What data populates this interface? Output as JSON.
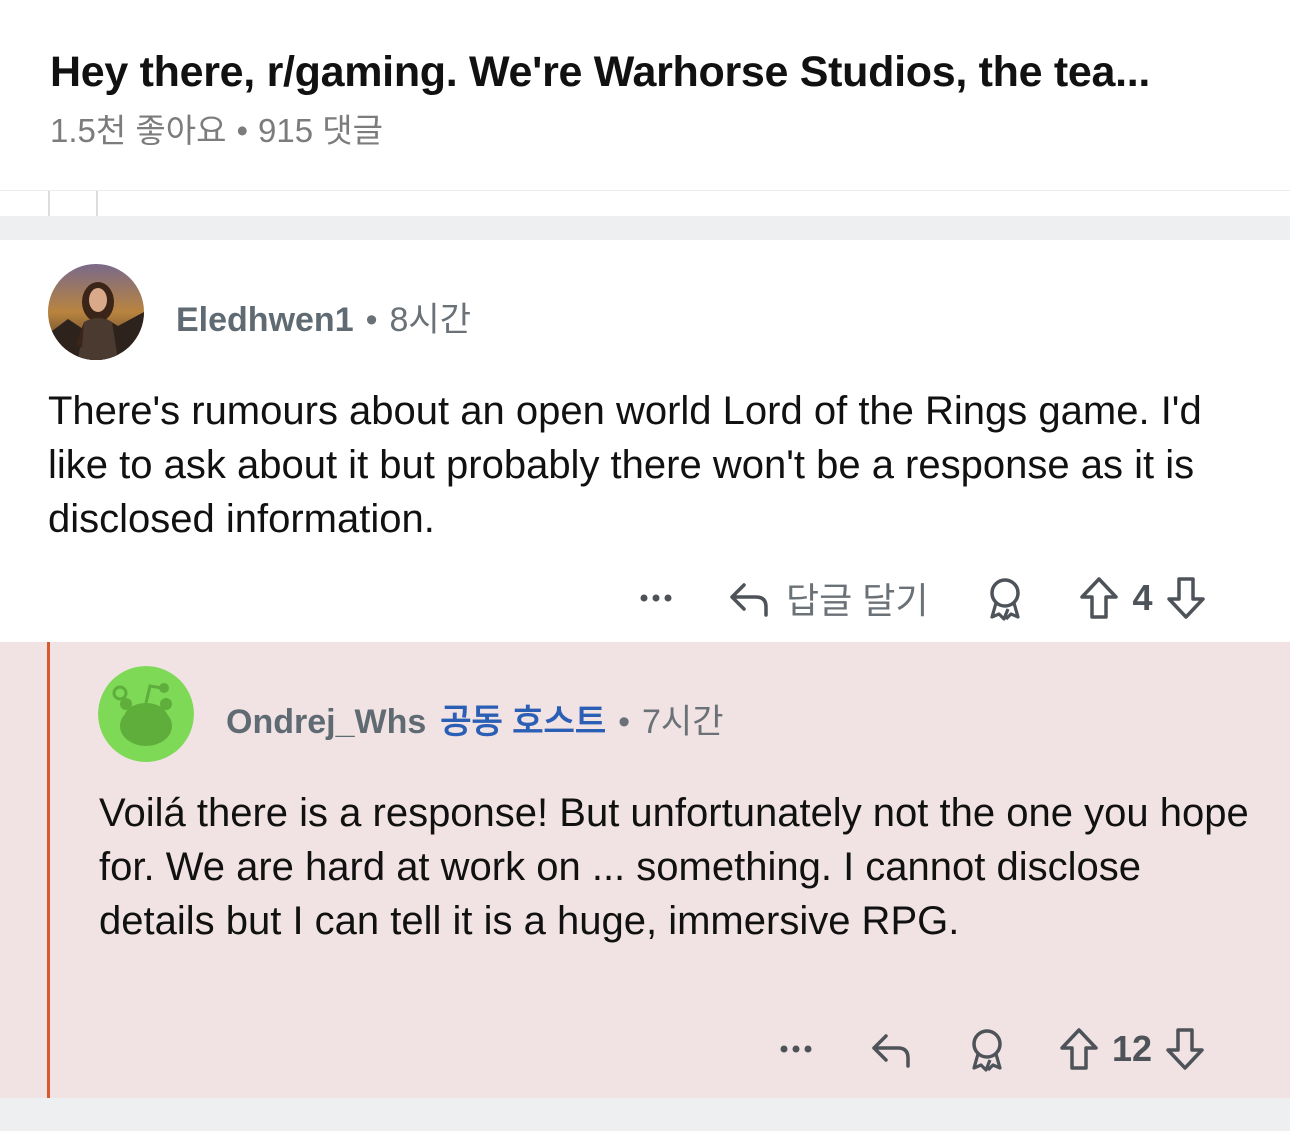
{
  "post": {
    "title": "Hey there, r/gaming. We're Warhorse Studios, the tea...",
    "likes": "1.5천 좋아요",
    "separator": "•",
    "comments": "915 댓글"
  },
  "comments": [
    {
      "username": "Eledhwen1",
      "separator": "•",
      "time": "8시간",
      "body": "There's rumours about an open world Lord of the Rings game. I'd like to ask about it but probably there won't be a response as it is disclosed information.",
      "reply_label": "답글 달기",
      "score": "4",
      "icons": [
        "more-icon",
        "reply-arrow-icon",
        "award-icon",
        "upvote-icon",
        "downvote-icon"
      ]
    },
    {
      "username": "Ondrej_Whs",
      "flair": "공동 호스트",
      "separator": "•",
      "time": "7시간",
      "body": "Voilá there is a response! But unfortunately not the one you hope for. We are hard at work on ... something. I cannot disclose details but I can tell it is a huge, immersive RPG.",
      "score": "12",
      "icons": [
        "more-icon",
        "reply-arrow-icon",
        "award-icon",
        "upvote-icon",
        "downvote-icon"
      ]
    }
  ],
  "colors": {
    "reply_background": "#f1e3e3",
    "reply_thread_bar": "#d8592c",
    "flair_text": "#2b5fb5",
    "avatar_green": "#7ed957"
  }
}
